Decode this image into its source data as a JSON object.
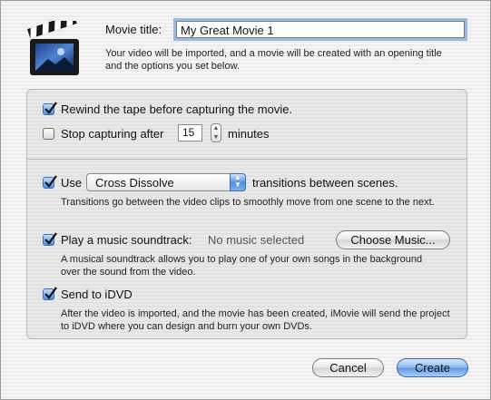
{
  "header": {
    "movie_title_label": "Movie title:",
    "movie_title_value": "My Great Movie 1",
    "intro_text": "Your video will be imported, and a movie will be created with an opening title and the options you set below."
  },
  "capture": {
    "rewind_label": "Rewind the tape before capturing the movie.",
    "rewind_checked": true,
    "stop_label": "Stop capturing after",
    "stop_checked": false,
    "stop_minutes_value": "15",
    "minutes_label": "minutes"
  },
  "transitions": {
    "use_label": "Use",
    "checked": true,
    "selected": "Cross Dissolve",
    "suffix_label": "transitions between scenes.",
    "description": "Transitions go between the video clips to smoothly move from one scene to the next."
  },
  "music": {
    "label": "Play a music soundtrack:",
    "checked": true,
    "status": "No music selected",
    "choose_button": "Choose Music...",
    "description": "A musical soundtrack allows you to play one of your own songs in the background over the sound from the video."
  },
  "idvd": {
    "label": "Send to iDVD",
    "checked": true,
    "description": "After the video is imported, and the movie has been created, iMovie will send the project to iDVD where you can design and burn your own DVDs."
  },
  "buttons": {
    "cancel": "Cancel",
    "create": "Create"
  },
  "icons": {
    "app_icon": "clapperboard-icon",
    "checkmark": "checkmark-icon",
    "stepper": "stepper-arrows-icon",
    "popup_arrows": "popup-arrows-icon"
  },
  "colors": {
    "accent": "#4e8ee2",
    "focus_ring": "#9ab9e6"
  }
}
